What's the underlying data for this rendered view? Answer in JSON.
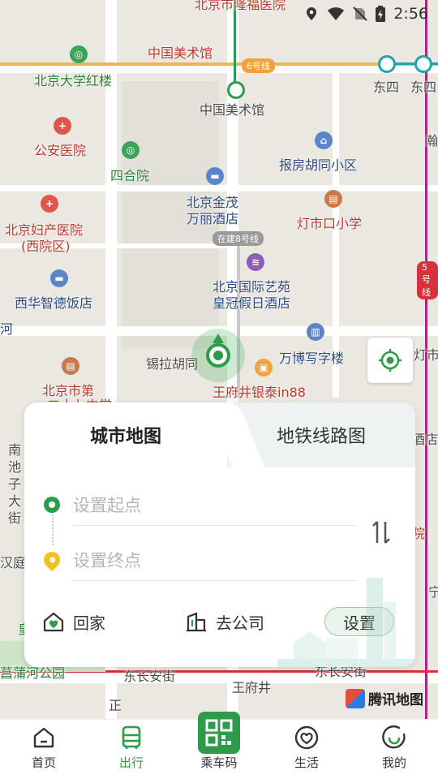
{
  "status_bar": {
    "time": "2:56"
  },
  "map": {
    "labels": {
      "top_hospital": "北京市隆福医院",
      "art_museum_top": "中国美术馆",
      "line6": "6号线",
      "dongsi1": "东四",
      "dongsi2": "东四",
      "peking_red": "北京大学红楼",
      "art_museum_station": "中国美术馆",
      "gongan_hospital": "公安医院",
      "siheyuan": "四合院",
      "baofang": "报房胡同小区",
      "hanrui": "瀚",
      "jinmao1": "北京金茂",
      "jinmao2": "万丽酒店",
      "dengshikou": "灯市口小学",
      "fuchan1": "北京妇产医院",
      "fuchan2": "(西院区)",
      "line8": "在建8号线",
      "line5": "5号线",
      "guoji1": "北京国际艺苑",
      "guoji2": "皇冠假日酒店",
      "xihua": "西华智德饭店",
      "he": "河",
      "xila": "锡拉胡同",
      "wanbo": "万博写字楼",
      "dengshi_right": "灯市",
      "in88": "王府井银泰in88",
      "beijing_di": "北京市第",
      "erqi": "二十七中学",
      "nanchizi": "南池子大街",
      "jiudian": "酒店",
      "yuan": "院",
      "hanting": "汉庭",
      "changpu": "菖蒲河公园",
      "dongchangan": "东长安街",
      "dongchangan2": "东长安街",
      "wangfujing": "王府井",
      "zheng": "正",
      "ning": "宁",
      "huang": "皇"
    }
  },
  "panel": {
    "tab_city": "城市地图",
    "tab_subway": "地铁线路图",
    "start_placeholder": "设置起点",
    "end_placeholder": "设置终点",
    "home_label": "回家",
    "work_label": "去公司",
    "settings_label": "设置"
  },
  "brand": "腾讯地图",
  "nav": {
    "items": [
      {
        "label": "首页"
      },
      {
        "label": "出行"
      },
      {
        "label": "乘车码"
      },
      {
        "label": "生活"
      },
      {
        "label": "我的"
      }
    ]
  },
  "colors": {
    "accent": "#2e9b4a",
    "pin": "#f0c020"
  }
}
